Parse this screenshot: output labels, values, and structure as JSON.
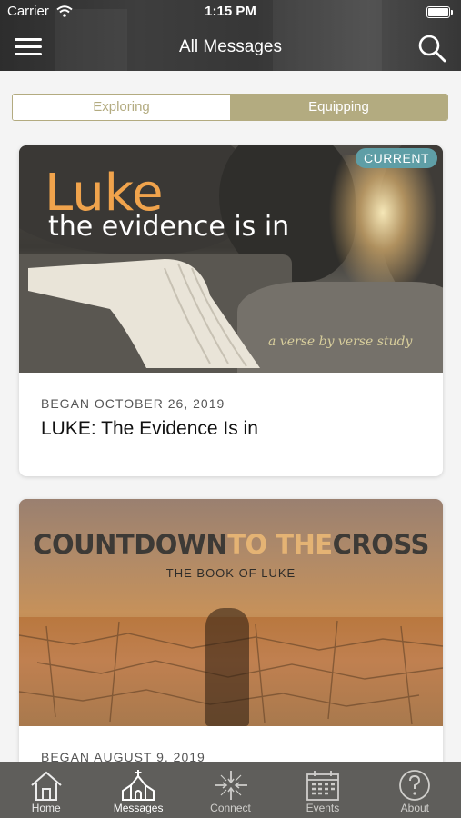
{
  "status_bar": {
    "carrier": "Carrier",
    "time": "1:15 PM"
  },
  "nav": {
    "title": "All Messages"
  },
  "segments": [
    {
      "label": "Exploring",
      "selected": false
    },
    {
      "label": "Equipping",
      "selected": true
    }
  ],
  "series": [
    {
      "badge": "CURRENT",
      "art_title": "Luke",
      "art_subtitle": "the evidence is in",
      "art_tagline": "a verse by verse study",
      "date": "BEGAN OCTOBER 26, 2019",
      "title": "LUKE: The Evidence Is in"
    },
    {
      "art_title_part1": "COUNTDOWN",
      "art_title_part2": "TO THE",
      "art_title_part3": "CROSS",
      "art_subtitle": "THE BOOK OF LUKE",
      "date": "BEGAN AUGUST 9, 2019"
    }
  ],
  "tabbar": [
    {
      "label": "Home",
      "icon": "home-icon"
    },
    {
      "label": "Messages",
      "icon": "church-icon",
      "active": true
    },
    {
      "label": "Connect",
      "icon": "connect-icon"
    },
    {
      "label": "Events",
      "icon": "calendar-icon"
    },
    {
      "label": "About",
      "icon": "question-icon"
    }
  ],
  "colors": {
    "accent": "#b3ab80",
    "badge": "#5f9ea6",
    "tabbar": "#5f5e5b"
  }
}
